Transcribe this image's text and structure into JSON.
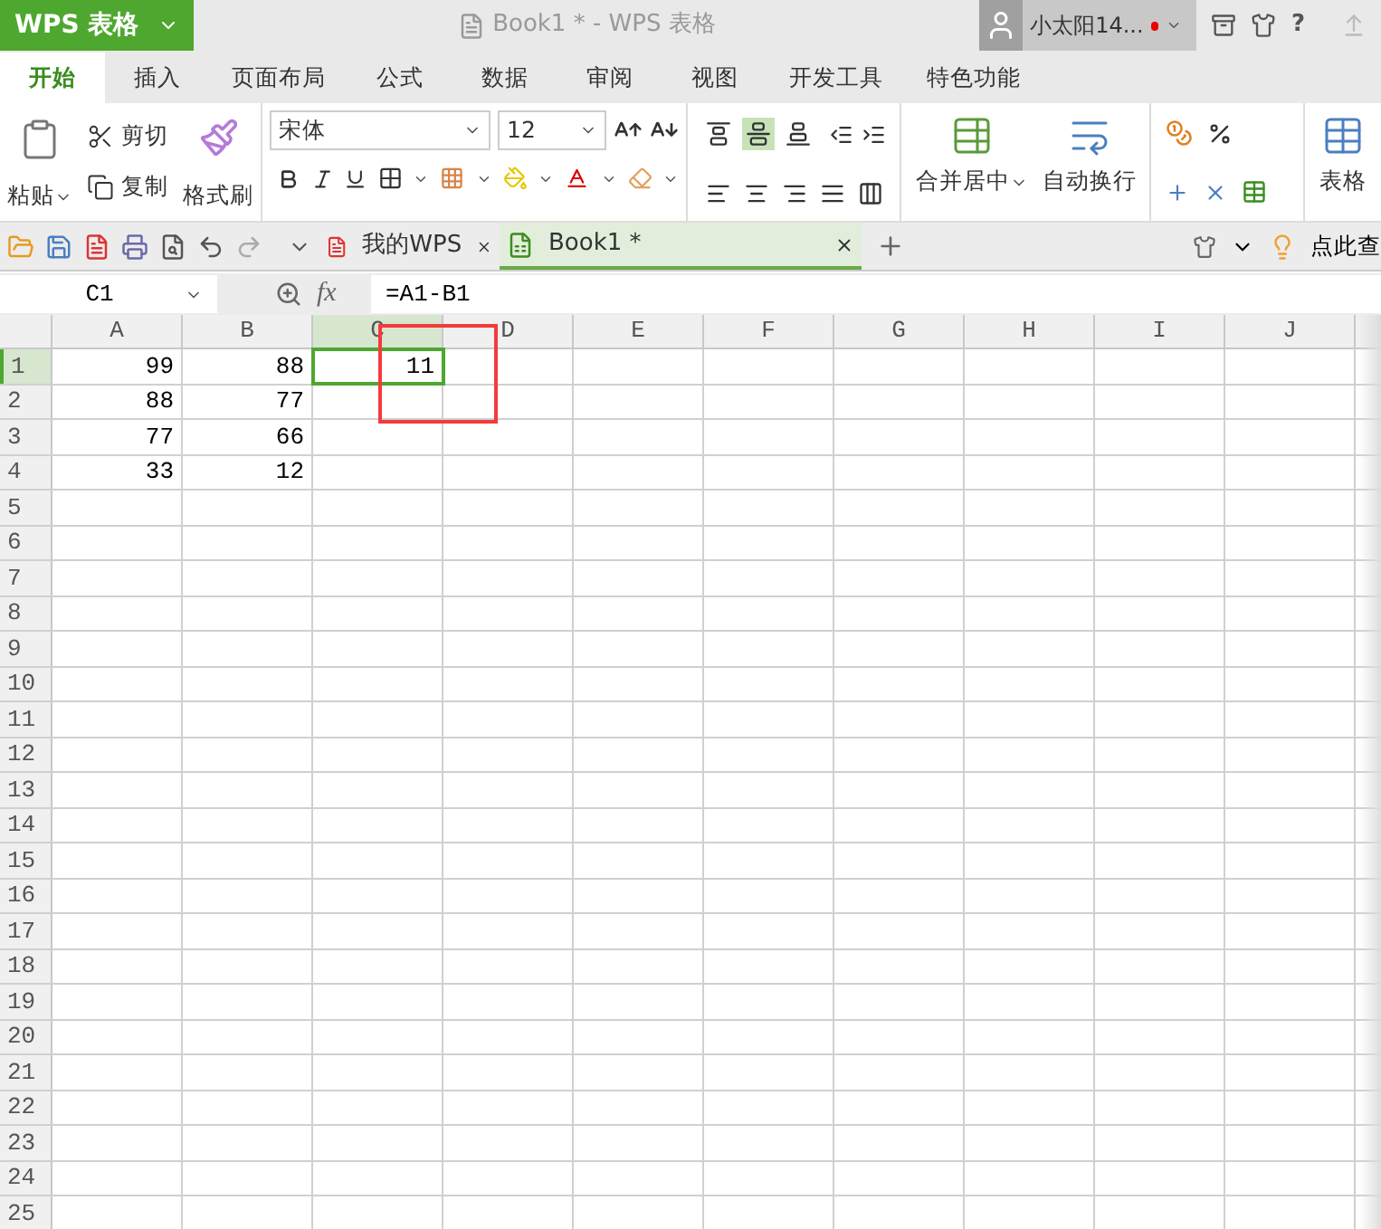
{
  "app_button": {
    "label": "WPS 表格"
  },
  "window_title": "Book1 * - WPS 表格",
  "user": {
    "name": "小太阳14...",
    "notification": true
  },
  "help_label": "?",
  "menu_tabs": [
    {
      "label": "开始",
      "selected": true
    },
    {
      "label": "插入",
      "selected": false
    },
    {
      "label": "页面布局",
      "selected": false
    },
    {
      "label": "公式",
      "selected": false
    },
    {
      "label": "数据",
      "selected": false
    },
    {
      "label": "审阅",
      "selected": false
    },
    {
      "label": "视图",
      "selected": false
    },
    {
      "label": "开发工具",
      "selected": false
    },
    {
      "label": "特色功能",
      "selected": false
    }
  ],
  "ribbon": {
    "paste": "粘贴",
    "cut": "剪切",
    "copy": "复制",
    "format_painter": "格式刷",
    "font_name": "宋体",
    "font_size": "12",
    "merge_center": "合并居中",
    "wrap_text": "自动换行",
    "table_style": "表格"
  },
  "alignment_buttons": [
    {
      "kind": "top",
      "selected": false
    },
    {
      "kind": "middle",
      "selected": true
    },
    {
      "kind": "bottom",
      "selected": false
    }
  ],
  "doc_tabs": [
    {
      "label": "我的WPS",
      "kind": "home",
      "selected": false
    },
    {
      "label": "Book1 *",
      "kind": "sheet",
      "selected": true
    }
  ],
  "search_hint": "点此查",
  "formula_bar": {
    "name_box": "C1",
    "function_label": "fx",
    "formula": "=A1-B1"
  },
  "columns": [
    {
      "label": "A",
      "selected": false
    },
    {
      "label": "B",
      "selected": false
    },
    {
      "label": "C",
      "selected": true
    },
    {
      "label": "D",
      "selected": false
    },
    {
      "label": "E",
      "selected": false
    },
    {
      "label": "F",
      "selected": false
    },
    {
      "label": "G",
      "selected": false
    },
    {
      "label": "H",
      "selected": false
    },
    {
      "label": "I",
      "selected": false
    },
    {
      "label": "J",
      "selected": false
    }
  ],
  "rows": [
    {
      "label": "1",
      "selected": true,
      "cells": [
        {
          "text": "99",
          "selected": false
        },
        {
          "text": "88",
          "selected": false
        },
        {
          "text": "11",
          "selected": true
        }
      ]
    },
    {
      "label": "2",
      "selected": false,
      "cells": [
        {
          "text": "88",
          "selected": false
        },
        {
          "text": "77",
          "selected": false
        }
      ]
    },
    {
      "label": "3",
      "selected": false,
      "cells": [
        {
          "text": "77",
          "selected": false
        },
        {
          "text": "66",
          "selected": false
        }
      ]
    },
    {
      "label": "4",
      "selected": false,
      "cells": [
        {
          "text": "33",
          "selected": false
        },
        {
          "text": "12",
          "selected": false
        }
      ]
    },
    {
      "label": "5",
      "selected": false
    },
    {
      "label": "6",
      "selected": false
    },
    {
      "label": "7",
      "selected": false
    },
    {
      "label": "8",
      "selected": false
    },
    {
      "label": "9",
      "selected": false
    },
    {
      "label": "10",
      "selected": false
    },
    {
      "label": "11",
      "selected": false
    },
    {
      "label": "12",
      "selected": false
    },
    {
      "label": "13",
      "selected": false
    },
    {
      "label": "14",
      "selected": false
    },
    {
      "label": "15",
      "selected": false
    },
    {
      "label": "16",
      "selected": false
    },
    {
      "label": "17",
      "selected": false
    },
    {
      "label": "18",
      "selected": false
    },
    {
      "label": "19",
      "selected": false
    },
    {
      "label": "20",
      "selected": false
    },
    {
      "label": "21",
      "selected": false
    },
    {
      "label": "22",
      "selected": false
    },
    {
      "label": "23",
      "selected": false
    },
    {
      "label": "24",
      "selected": false
    },
    {
      "label": "25",
      "selected": false
    }
  ],
  "annotations": [
    {
      "kind": "rectangle"
    }
  ]
}
